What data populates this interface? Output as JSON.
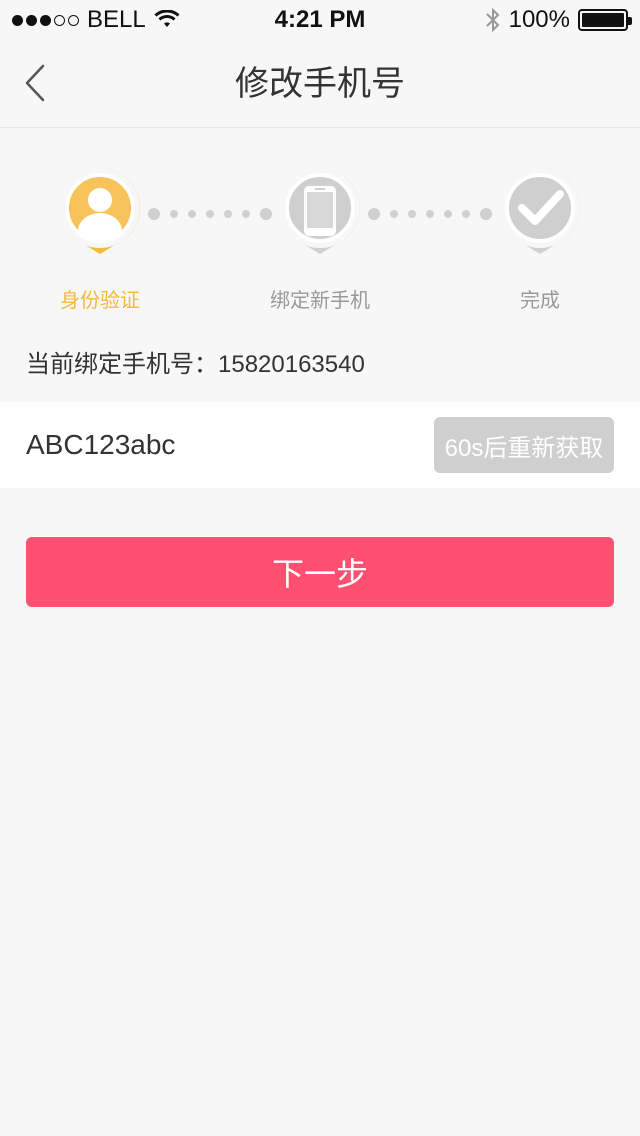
{
  "status_bar": {
    "carrier": "BELL",
    "time": "4:21 PM",
    "battery_text": "100%",
    "battery_level": 1.0
  },
  "nav": {
    "title": "修改手机号",
    "back_icon": "chevron-left-icon"
  },
  "steps": [
    {
      "label": "身份验证",
      "icon": "user-icon",
      "state": "active"
    },
    {
      "label": "绑定新手机",
      "icon": "phone-icon",
      "state": "inactive"
    },
    {
      "label": "完成",
      "icon": "check-icon",
      "state": "inactive"
    }
  ],
  "current_phone": {
    "text": "当前绑定手机号：15820163540"
  },
  "code_input": {
    "value": "ABC123abc"
  },
  "resend_button": {
    "label": "60s后重新获取"
  },
  "next_button": {
    "label": "下一步"
  },
  "colors": {
    "accent_active": "#f5b93c",
    "primary_button": "#ff5071",
    "disabled_button": "#cfcfcf",
    "inactive_icon": "#d0d0d0"
  }
}
